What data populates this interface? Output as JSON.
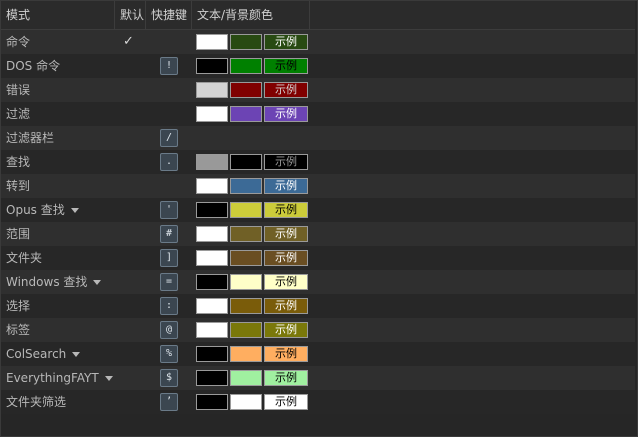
{
  "header": {
    "mode": "模式",
    "default": "默认",
    "shortcut": "快捷键",
    "colors": "文本/背景颜色"
  },
  "check_glyph": "✓",
  "rows": [
    {
      "name": "命令",
      "dropdown": false,
      "default": true,
      "key": "",
      "fg": "#ffffff",
      "bg": "#284a12",
      "sample": "示例"
    },
    {
      "name": "DOS 命令",
      "dropdown": false,
      "default": false,
      "key": "!",
      "fg": "#000000",
      "bg": "#008000",
      "sample": "示例"
    },
    {
      "name": "错误",
      "dropdown": false,
      "default": false,
      "key": "",
      "fg": "#d3d3d3",
      "bg": "#800000",
      "sample": "示例"
    },
    {
      "name": "过滤",
      "dropdown": false,
      "default": false,
      "key": "",
      "fg": "#ffffff",
      "bg": "#6c44b4",
      "sample": "示例"
    },
    {
      "name": "过滤器栏",
      "dropdown": false,
      "default": false,
      "key": "/",
      "fg": "",
      "bg": "",
      "sample": ""
    },
    {
      "name": "查找",
      "dropdown": false,
      "default": false,
      "key": ".",
      "fg": "#999999",
      "bg": "#000000",
      "sample": "示例"
    },
    {
      "name": "转到",
      "dropdown": false,
      "default": false,
      "key": "",
      "fg": "#ffffff",
      "bg": "#3c6a96",
      "sample": "示例"
    },
    {
      "name": "Opus 查找",
      "dropdown": true,
      "default": false,
      "key": "'",
      "fg": "#000000",
      "bg": "#cccc3a",
      "sample": "示例"
    },
    {
      "name": "范围",
      "dropdown": false,
      "default": false,
      "key": "#",
      "fg": "#ffffff",
      "bg": "#706026",
      "sample": "示例"
    },
    {
      "name": "文件夹",
      "dropdown": false,
      "default": false,
      "key": "]",
      "fg": "#ffffff",
      "bg": "#6a4e22",
      "sample": "示例"
    },
    {
      "name": "Windows 查找",
      "dropdown": true,
      "default": false,
      "key": "=",
      "fg": "#000000",
      "bg": "#ffffc8",
      "sample": "示例"
    },
    {
      "name": "选择",
      "dropdown": false,
      "default": false,
      "key": ":",
      "fg": "#ffffff",
      "bg": "#7a5c0a",
      "sample": "示例"
    },
    {
      "name": "标签",
      "dropdown": false,
      "default": false,
      "key": "@",
      "fg": "#ffffff",
      "bg": "#7a780a",
      "sample": "示例"
    },
    {
      "name": "ColSearch",
      "dropdown": true,
      "default": false,
      "key": "%",
      "fg": "#000000",
      "bg": "#ffae60",
      "sample": "示例"
    },
    {
      "name": "EverythingFAYT",
      "dropdown": true,
      "default": false,
      "key": "$",
      "fg": "#000000",
      "bg": "#a0f0a0",
      "sample": "示例"
    },
    {
      "name": "文件夹筛选",
      "dropdown": false,
      "default": false,
      "key": "’",
      "fg": "#000000",
      "bg": "#ffffff",
      "sample": "示例"
    }
  ]
}
